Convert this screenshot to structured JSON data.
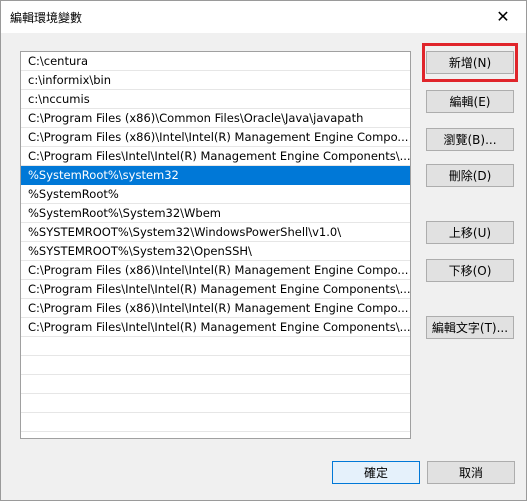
{
  "window": {
    "title": "編輯環境變數",
    "close_glyph": "✕"
  },
  "list": {
    "items": [
      "C:\\centura",
      "c:\\informix\\bin",
      "c:\\nccumis",
      "C:\\Program Files (x86)\\Common Files\\Oracle\\Java\\javapath",
      "C:\\Program Files (x86)\\Intel\\Intel(R) Management Engine Compo...",
      "C:\\Program Files\\Intel\\Intel(R) Management Engine Components\\...",
      "%SystemRoot%\\system32",
      "%SystemRoot%",
      "%SystemRoot%\\System32\\Wbem",
      "%SYSTEMROOT%\\System32\\WindowsPowerShell\\v1.0\\",
      "%SYSTEMROOT%\\System32\\OpenSSH\\",
      "C:\\Program Files (x86)\\Intel\\Intel(R) Management Engine Compo...",
      "C:\\Program Files\\Intel\\Intel(R) Management Engine Components\\...",
      "C:\\Program Files (x86)\\Intel\\Intel(R) Management Engine Compo...",
      "C:\\Program Files\\Intel\\Intel(R) Management Engine Components\\..."
    ],
    "selected_index": 6
  },
  "buttons": {
    "new": "新增(N)",
    "edit": "編輯(E)",
    "browse": "瀏覽(B)...",
    "delete": "刪除(D)",
    "move_up": "上移(U)",
    "move_down": "下移(O)",
    "edit_text": "編輯文字(T)...",
    "ok": "確定",
    "cancel": "取消"
  },
  "colors": {
    "selection": "#0078d7",
    "highlight_box": "#e0252b"
  }
}
